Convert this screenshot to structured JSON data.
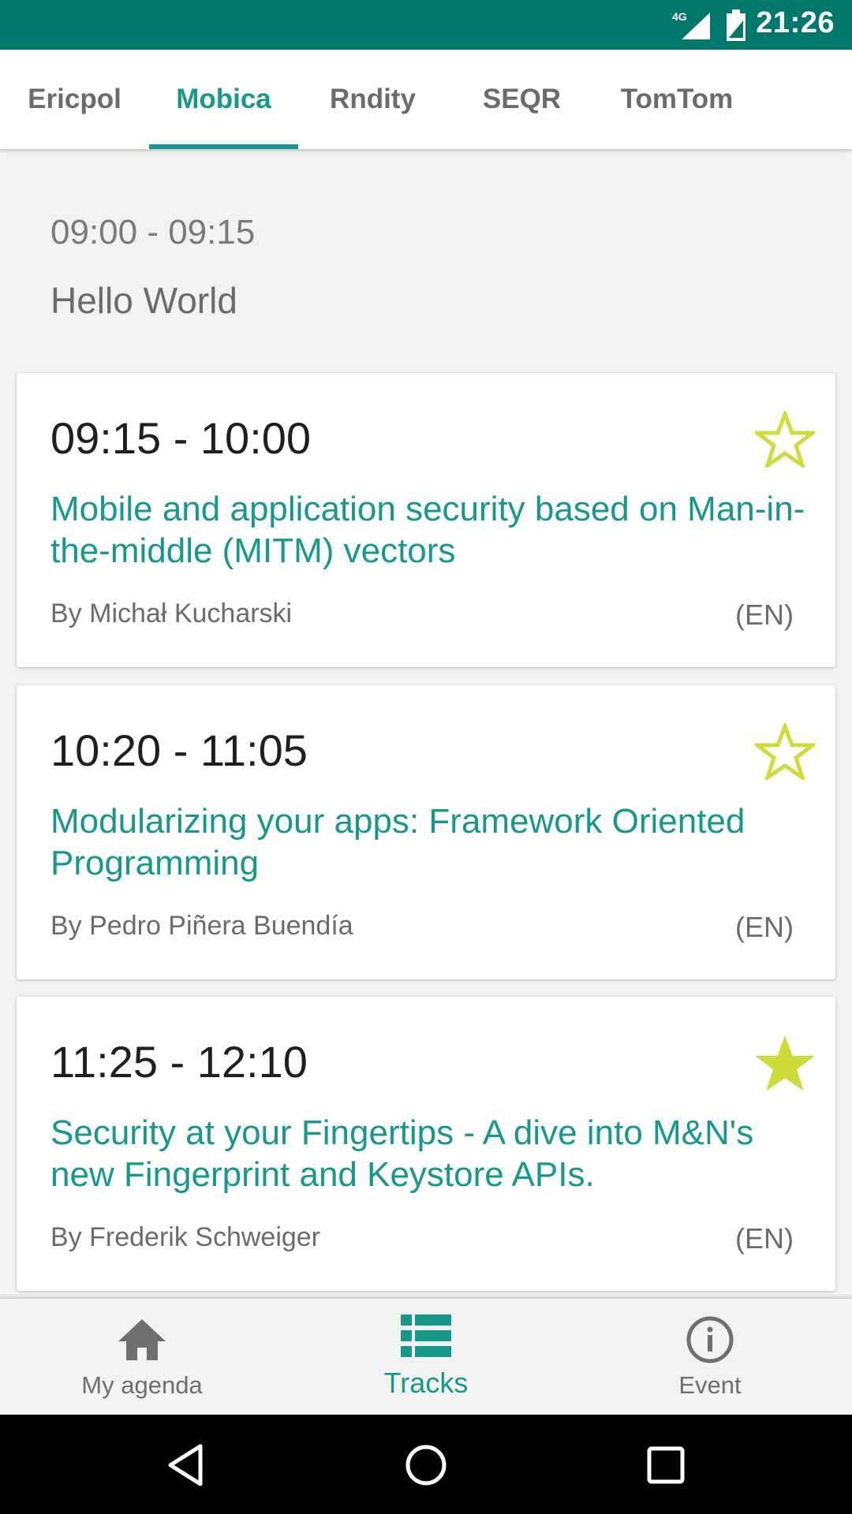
{
  "status_bar": {
    "time": "21:26",
    "network": "4G"
  },
  "tabs": [
    {
      "label": "Ericpol",
      "active": false
    },
    {
      "label": "Mobica",
      "active": true
    },
    {
      "label": "Rndity",
      "active": false
    },
    {
      "label": "SEQR",
      "active": false
    },
    {
      "label": "TomTom",
      "active": false
    }
  ],
  "break_item": {
    "time": "09:00 - 09:15",
    "title": "Hello World"
  },
  "sessions": [
    {
      "time": "09:15 - 10:00",
      "title": "Mobile and application security based on Man-in-the-middle (MITM) vectors",
      "speaker": "By Michał Kucharski",
      "language": "(EN)",
      "starred": false
    },
    {
      "time": "10:20 - 11:05",
      "title": "Modularizing your apps: Framework Oriented Programming",
      "speaker": "By Pedro Piñera Buendía",
      "language": "(EN)",
      "starred": false
    },
    {
      "time": "11:25 - 12:10",
      "title": "Security at your Fingertips - A dive into M&N's new Fingerprint and Keystore APIs.",
      "speaker": "By Frederik Schweiger",
      "language": "(EN)",
      "starred": true
    }
  ],
  "bottom_nav": {
    "items": [
      {
        "label": "My agenda",
        "icon": "home-icon",
        "active": false
      },
      {
        "label": "Tracks",
        "icon": "list-icon",
        "active": true
      },
      {
        "label": "Event",
        "icon": "info-icon",
        "active": false
      }
    ]
  },
  "colors": {
    "status_bar": "#00786b",
    "accent": "#16988a",
    "star": "#cddc39"
  }
}
